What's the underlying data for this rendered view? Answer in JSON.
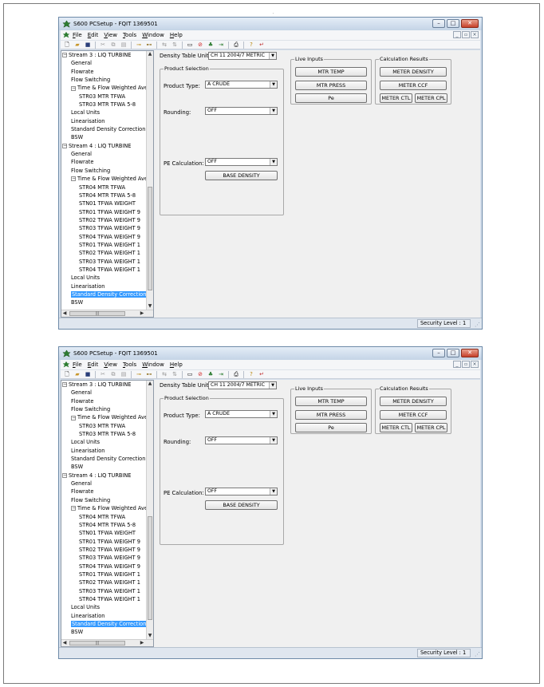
{
  "screens": [
    {
      "window": {
        "title": "S600 PCSetup - FQIT 1369501"
      },
      "menu": [
        "File",
        "Edit",
        "View",
        "Tools",
        "Window",
        "Help"
      ],
      "tree": [
        {
          "label": "Stream 3 : LIQ TURBINE",
          "level": 0,
          "toggle": "−"
        },
        {
          "label": "General",
          "level": 1
        },
        {
          "label": "Flowrate",
          "level": 1
        },
        {
          "label": "Flow Switching",
          "level": 1
        },
        {
          "label": "Time & Flow Weighted Ave",
          "level": 1,
          "toggle": "−"
        },
        {
          "label": "STR03 MTR TFWA",
          "level": 2
        },
        {
          "label": "STR03 MTR TFWA 5-8",
          "level": 2
        },
        {
          "label": "Local Units",
          "level": 1
        },
        {
          "label": "Linearisation",
          "level": 1
        },
        {
          "label": "Standard Density Correction",
          "level": 1
        },
        {
          "label": "BSW",
          "level": 1
        },
        {
          "label": "Stream 4 : LIQ TURBINE",
          "level": 0,
          "toggle": "−"
        },
        {
          "label": "General",
          "level": 1
        },
        {
          "label": "Flowrate",
          "level": 1
        },
        {
          "label": "Flow Switching",
          "level": 1
        },
        {
          "label": "Time & Flow Weighted Ave",
          "level": 1,
          "toggle": "−"
        },
        {
          "label": "STR04 MTR TFWA",
          "level": 2
        },
        {
          "label": "STR04 MTR TFWA 5-8",
          "level": 2
        },
        {
          "label": "STN01 TFWA WEIGHT",
          "level": 2
        },
        {
          "label": "STR01 TFWA WEIGHT 9",
          "level": 2
        },
        {
          "label": "STR02 TFWA WEIGHT 9",
          "level": 2
        },
        {
          "label": "STR03 TFWA WEIGHT 9",
          "level": 2
        },
        {
          "label": "STR04 TFWA WEIGHT 9",
          "level": 2
        },
        {
          "label": "STR01 TFWA WEIGHT 1",
          "level": 2
        },
        {
          "label": "STR02 TFWA WEIGHT 1",
          "level": 2
        },
        {
          "label": "STR03 TFWA WEIGHT 1",
          "level": 2
        },
        {
          "label": "STR04 TFWA WEIGHT 1",
          "level": 2
        },
        {
          "label": "Local Units",
          "level": 1
        },
        {
          "label": "Linearisation",
          "level": 1
        },
        {
          "label": "Standard Density Correction",
          "level": 1,
          "selected": true
        },
        {
          "label": "BSW",
          "level": 1
        }
      ],
      "form": {
        "density_table_label": "Density Table Units:",
        "density_table_value": "CH 11 2004/7 METRIC",
        "product_selection_title": "Product Selection",
        "product_type_label": "Product Type:",
        "product_type_value": "A CRUDE",
        "rounding_label": "Rounding:",
        "rounding_value": "OFF",
        "pe_calc_label": "PE Calculation:",
        "pe_calc_value": "OFF",
        "base_density_button": "BASE DENSITY"
      },
      "live_inputs": {
        "title": "Live Inputs",
        "buttons": [
          "MTR TEMP",
          "MTR PRESS",
          "Pe"
        ]
      },
      "calc_results": {
        "title": "Calculation Results",
        "meter_density": "METER DENSITY",
        "meter_ccf": "METER CCF",
        "meter_ctl": "METER CTL",
        "meter_cpl": "METER CPL"
      },
      "status": {
        "security": "Security Level : 1"
      }
    },
    {
      "window": {
        "title": "S600 PCSetup - FQIT 1369501"
      },
      "menu": [
        "File",
        "Edit",
        "View",
        "Tools",
        "Window",
        "Help"
      ],
      "tree": [
        {
          "label": "Stream 3 : LIQ TURBINE",
          "level": 0,
          "toggle": "−"
        },
        {
          "label": "General",
          "level": 1
        },
        {
          "label": "Flowrate",
          "level": 1
        },
        {
          "label": "Flow Switching",
          "level": 1
        },
        {
          "label": "Time & Flow Weighted Ave",
          "level": 1,
          "toggle": "−"
        },
        {
          "label": "STR03 MTR TFWA",
          "level": 2
        },
        {
          "label": "STR03 MTR TFWA 5-8",
          "level": 2
        },
        {
          "label": "Local Units",
          "level": 1
        },
        {
          "label": "Linearisation",
          "level": 1
        },
        {
          "label": "Standard Density Correction",
          "level": 1
        },
        {
          "label": "BSW",
          "level": 1
        },
        {
          "label": "Stream 4 : LIQ TURBINE",
          "level": 0,
          "toggle": "−"
        },
        {
          "label": "General",
          "level": 1
        },
        {
          "label": "Flowrate",
          "level": 1
        },
        {
          "label": "Flow Switching",
          "level": 1
        },
        {
          "label": "Time & Flow Weighted Ave",
          "level": 1,
          "toggle": "−"
        },
        {
          "label": "STR04 MTR TFWA",
          "level": 2
        },
        {
          "label": "STR04 MTR TFWA 5-8",
          "level": 2
        },
        {
          "label": "STN01 TFWA WEIGHT",
          "level": 2
        },
        {
          "label": "STR01 TFWA WEIGHT 9",
          "level": 2
        },
        {
          "label": "STR02 TFWA WEIGHT 9",
          "level": 2
        },
        {
          "label": "STR03 TFWA WEIGHT 9",
          "level": 2
        },
        {
          "label": "STR04 TFWA WEIGHT 9",
          "level": 2
        },
        {
          "label": "STR01 TFWA WEIGHT 1",
          "level": 2
        },
        {
          "label": "STR02 TFWA WEIGHT 1",
          "level": 2
        },
        {
          "label": "STR03 TFWA WEIGHT 1",
          "level": 2
        },
        {
          "label": "STR04 TFWA WEIGHT 1",
          "level": 2
        },
        {
          "label": "Local Units",
          "level": 1
        },
        {
          "label": "Linearisation",
          "level": 1
        },
        {
          "label": "Standard Density Correction",
          "level": 1,
          "selected": true
        },
        {
          "label": "BSW",
          "level": 1
        }
      ],
      "form": {
        "density_table_label": "Density Table Units:",
        "density_table_value": "CH 11 2004/7 METRIC",
        "product_selection_title": "Product Selection",
        "product_type_label": "Product Type:",
        "product_type_value": "A CRUDE",
        "rounding_label": "Rounding:",
        "rounding_value": "OFF",
        "pe_calc_label": "PE Calculation:",
        "pe_calc_value": "OFF",
        "base_density_button": "BASE DENSITY"
      },
      "live_inputs": {
        "title": "Live Inputs",
        "buttons": [
          "MTR TEMP",
          "MTR PRESS",
          "Pe"
        ]
      },
      "calc_results": {
        "title": "Calculation Results",
        "meter_density": "METER DENSITY",
        "meter_ccf": "METER CCF",
        "meter_ctl": "METER CTL",
        "meter_cpl": "METER CPL"
      },
      "status": {
        "security": "Security Level : 1"
      }
    }
  ],
  "icons": [
    "app-icon",
    "new-icon",
    "open-icon",
    "save-icon",
    "cut-icon",
    "copy-icon",
    "paste-icon",
    "connect-icon",
    "disconnect-icon",
    "compare-icon",
    "transfer-icon",
    "stop-icon",
    "tree-icon",
    "export-icon",
    "print-icon",
    "help-icon",
    "back-icon"
  ],
  "colors": {
    "selection": "#3399ff",
    "window_frame": "#d6e0ec",
    "close_button": "#c6402a"
  }
}
